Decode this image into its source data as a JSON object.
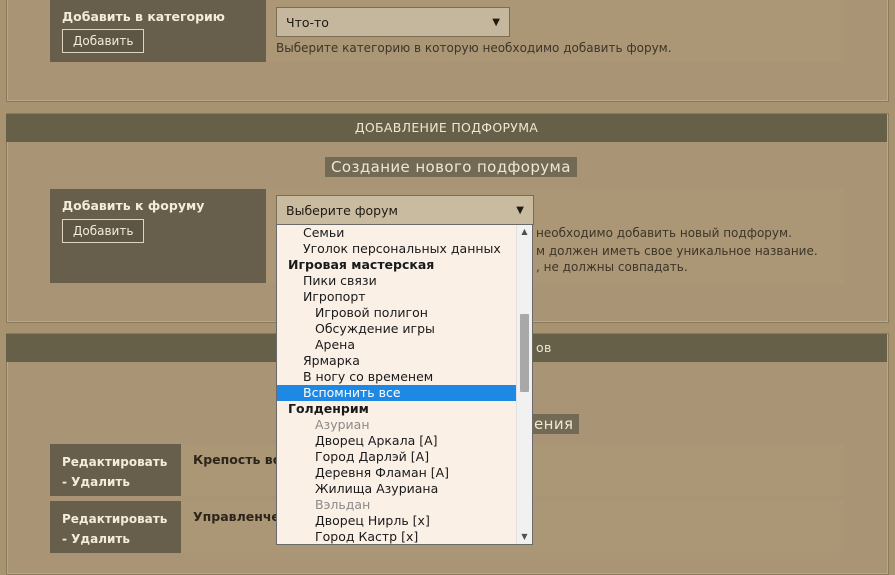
{
  "top_section": {
    "label": "Добавить в категорию",
    "button": "Добавить",
    "select_value": "Что-то",
    "help": "Выберите категорию в которую необходимо добавить форум."
  },
  "subforum_section": {
    "header": "ДОБАВЛЕНИЕ ПОДФОРУМА",
    "subtitle": "Создание нового подфорума",
    "label": "Добавить к форуму",
    "button": "Добавить",
    "select_value": "Выберите форум",
    "help_lines": [
      "необходимо добавить новый подфорум.",
      "м должен иметь свое уникальное название.",
      ", не должны совпадать."
    ]
  },
  "list_section": {
    "header_fragment": "ов",
    "subtitle_fragment": "ения",
    "rows": [
      {
        "edit": "Редактировать",
        "delete": "Удалить",
        "name": "Крепость во"
      },
      {
        "edit": "Редактировать",
        "delete": "Удалить",
        "name": "Управленче"
      }
    ],
    "delete_prefix": "-"
  },
  "dropdown": {
    "items": [
      {
        "label": "Семьи",
        "kind": "l1"
      },
      {
        "label": "Уголок персональных данных",
        "kind": "l1"
      },
      {
        "label": "Игровая мастерская",
        "kind": "group"
      },
      {
        "label": "Пики связи",
        "kind": "l1"
      },
      {
        "label": "Игропорт",
        "kind": "l1"
      },
      {
        "label": "Игровой полигон",
        "kind": "l2"
      },
      {
        "label": "Обсуждение игры",
        "kind": "l2"
      },
      {
        "label": "Арена",
        "kind": "l2"
      },
      {
        "label": "Ярмарка",
        "kind": "l1"
      },
      {
        "label": "В ногу со временем",
        "kind": "l1"
      },
      {
        "label": "Вспомнить все",
        "kind": "l1",
        "selected": true
      },
      {
        "label": "Голденрим",
        "kind": "group"
      },
      {
        "label": "Азуриан",
        "kind": "l2",
        "disabled": true
      },
      {
        "label": "Дворец Аркала [A]",
        "kind": "l2"
      },
      {
        "label": "Город Дарлэй [A]",
        "kind": "l2"
      },
      {
        "label": "Деревня Фламан [A]",
        "kind": "l2"
      },
      {
        "label": "Жилища Азуриана",
        "kind": "l2"
      },
      {
        "label": "Вэльдан",
        "kind": "l2",
        "disabled": true
      },
      {
        "label": "Дворец Нирль [x]",
        "kind": "l2"
      },
      {
        "label": "Город Кастр [x]",
        "kind": "l2"
      }
    ],
    "scroll_position": 0.35
  },
  "colors": {
    "accent_selection": "#1e88e5",
    "header_bg": "#676049",
    "panel_bg": "#a99575"
  }
}
